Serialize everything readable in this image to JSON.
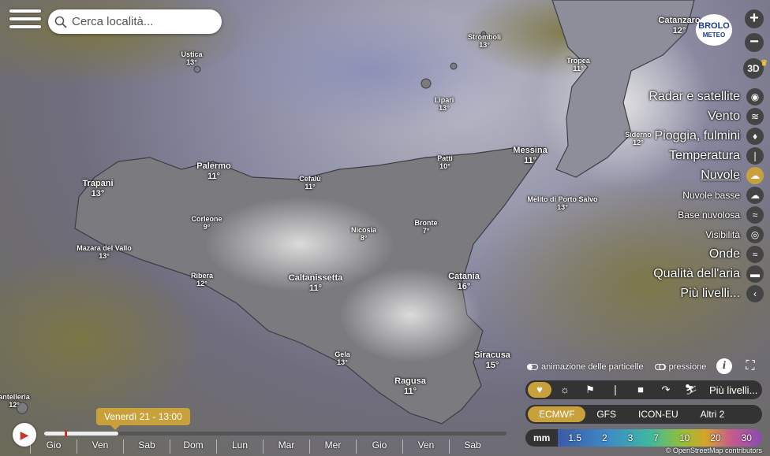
{
  "search": {
    "placeholder": "Cerca località..."
  },
  "logo": {
    "line1": "BROLO",
    "line2": "METEO"
  },
  "zoom": {
    "in": "+",
    "out": "−"
  },
  "view_3d": {
    "label": "3D"
  },
  "cities": [
    {
      "name": "Ustica",
      "temp": "13°"
    },
    {
      "name": "Stromboli",
      "temp": "13°"
    },
    {
      "name": "Catanzaro",
      "temp": "12°"
    },
    {
      "name": "Tropea",
      "temp": "11°"
    },
    {
      "name": "Lipari",
      "temp": "13°"
    },
    {
      "name": "Siderno",
      "temp": "12°"
    },
    {
      "name": "Patti",
      "temp": "10°"
    },
    {
      "name": "Messina",
      "temp": "11°"
    },
    {
      "name": "Palermo",
      "temp": "11°"
    },
    {
      "name": "Cefalù",
      "temp": "11°"
    },
    {
      "name": "Trapani",
      "temp": "13°"
    },
    {
      "name": "Melito di Porto Salvo",
      "temp": "13°"
    },
    {
      "name": "Corleone",
      "temp": "9°"
    },
    {
      "name": "Nicosia",
      "temp": "8°"
    },
    {
      "name": "Bronte",
      "temp": "7°"
    },
    {
      "name": "Mazara del Vallo",
      "temp": "13°"
    },
    {
      "name": "Ribera",
      "temp": "12°"
    },
    {
      "name": "Caltanissetta",
      "temp": "11°"
    },
    {
      "name": "Catania",
      "temp": "16°"
    },
    {
      "name": "Siracusa",
      "temp": "15°"
    },
    {
      "name": "Gela",
      "temp": "13°"
    },
    {
      "name": "Ragusa",
      "temp": "11°"
    },
    {
      "name": "antelleria",
      "temp": "12°"
    }
  ],
  "layers": [
    {
      "label": "Radar e satellite",
      "icon": "globe-icon",
      "glyph": "◉"
    },
    {
      "label": "Vento",
      "icon": "wind-icon",
      "glyph": "≋"
    },
    {
      "label": "Pioggia, fulmini",
      "icon": "raindrop-icon",
      "glyph": "♦"
    },
    {
      "label": "Temperatura",
      "icon": "thermometer-icon",
      "glyph": "❘"
    },
    {
      "label": "Nuvole",
      "icon": "cloud-icon",
      "glyph": "☁"
    },
    {
      "label": "Nuvole basse",
      "icon": "low-cloud-icon",
      "glyph": "☁"
    },
    {
      "label": "Base nuvolosa",
      "icon": "cloud-base-icon",
      "glyph": "≈"
    },
    {
      "label": "Visibilità",
      "icon": "eye-icon",
      "glyph": "◎"
    },
    {
      "label": "Onde",
      "icon": "waves-icon",
      "glyph": "≈"
    },
    {
      "label": "Qualità dell'aria",
      "icon": "car-icon",
      "glyph": "▬"
    },
    {
      "label": "Più livelli...",
      "icon": "chevron-left-icon",
      "glyph": "‹"
    }
  ],
  "options": {
    "particles": "animazione delle particelle",
    "pressure": "pressione",
    "info": "i",
    "fullscreen": "⛶"
  },
  "products": {
    "items": [
      {
        "icon": "heart-icon",
        "glyph": "♥"
      },
      {
        "icon": "sun-cloud-icon",
        "glyph": "☼"
      },
      {
        "icon": "flag-icon",
        "glyph": "⚑"
      },
      {
        "icon": "thermometer-icon",
        "glyph": "❘"
      },
      {
        "icon": "camera-icon",
        "glyph": "■"
      },
      {
        "icon": "wave-icon",
        "glyph": "↷"
      },
      {
        "icon": "ski-icon",
        "glyph": "⛷"
      }
    ],
    "more": "Più livelli..."
  },
  "models": {
    "items": [
      "ECMWF",
      "GFS",
      "ICON-EU",
      "Altri 2"
    ],
    "selected": "ECMWF"
  },
  "legend": {
    "unit": "mm",
    "values": [
      "1.5",
      "2",
      "3",
      "7",
      "10",
      "20",
      "30"
    ]
  },
  "timeline": {
    "current": "Venerdì 21 - 13:00",
    "progress": 0.16,
    "days": [
      "Gio",
      "Ven",
      "Sab",
      "Dom",
      "Lun",
      "Mar",
      "Mer",
      "Gio",
      "Ven",
      "Sab"
    ]
  },
  "attribution": "© OpenStreetMap contributors",
  "colors": {
    "accent": "#c9a13c",
    "panel": "#333333",
    "play": "#c0392b"
  }
}
